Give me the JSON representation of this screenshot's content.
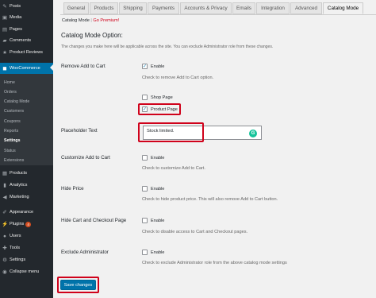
{
  "sidebar": {
    "top_items": [
      {
        "label": "Posts",
        "icon": "pin-icon"
      },
      {
        "label": "Media",
        "icon": "media-icon"
      },
      {
        "label": "Pages",
        "icon": "page-icon"
      },
      {
        "label": "Comments",
        "icon": "comment-icon"
      },
      {
        "label": "Product Reviews",
        "icon": "star-icon"
      },
      {
        "label": "WooCommerce",
        "icon": "woo-icon"
      }
    ],
    "woo_submenu": [
      "Home",
      "Orders",
      "Catalog Mode",
      "Customers",
      "Coupons",
      "Reports",
      "Settings",
      "Status",
      "Extensions"
    ],
    "bottom_items": [
      {
        "label": "Products",
        "icon": "box-icon"
      },
      {
        "label": "Analytics",
        "icon": "chart-icon"
      },
      {
        "label": "Marketing",
        "icon": "megaphone-icon"
      },
      {
        "label": "Appearance",
        "icon": "brush-icon"
      },
      {
        "label": "Plugins",
        "icon": "plug-icon",
        "badge": "4"
      },
      {
        "label": "Users",
        "icon": "user-icon"
      },
      {
        "label": "Tools",
        "icon": "wrench-icon"
      },
      {
        "label": "Settings",
        "icon": "settings-icon"
      },
      {
        "label": "Collapse menu",
        "icon": "collapse-icon"
      }
    ]
  },
  "tabs": [
    "General",
    "Products",
    "Shipping",
    "Payments",
    "Accounts & Privacy",
    "Emails",
    "Integration",
    "Advanced",
    "Catalog Mode"
  ],
  "subnav": {
    "current": "Catalog Mode",
    "separator": "|",
    "premium": "Go Premium!"
  },
  "section": {
    "title": "Catalog Mode Option:",
    "intro": "The changes you make here will be applicable across the site. You can exclude Administrator role from these changes."
  },
  "rows": {
    "remove_add_to_cart": {
      "label": "Remove Add to Cart",
      "enable": "Enable",
      "desc": "Check to remove Add to Cart option."
    },
    "shop_page": {
      "label": "Shop Page"
    },
    "product_page": {
      "label": "Product Page"
    },
    "placeholder": {
      "label": "Placeholder Text",
      "value": "Stock limited."
    },
    "customize": {
      "label": "Customize Add to Cart",
      "enable": "Enable",
      "desc": "Check to customize Add to Cart."
    },
    "hide_price": {
      "label": "Hide Price",
      "enable": "Enable",
      "desc": "Check to hide product price. This will also remove Add to Cart button."
    },
    "hide_cart_checkout": {
      "label": "Hide Cart and Checkout Page",
      "enable": "Enable",
      "desc": "Check to disable access to Cart and Checkout pages."
    },
    "exclude_admin": {
      "label": "Exclude Administrator",
      "enable": "Enable",
      "desc": "Check to exclude Administrator role from the above catalog mode settings"
    }
  },
  "save_button": "Save changes",
  "grammarly_letter": "G",
  "colors": {
    "sidebar_bg": "#23282d",
    "active_blue": "#0073aa",
    "highlight_red": "#d0021b",
    "grammarly_green": "#15c39a"
  }
}
